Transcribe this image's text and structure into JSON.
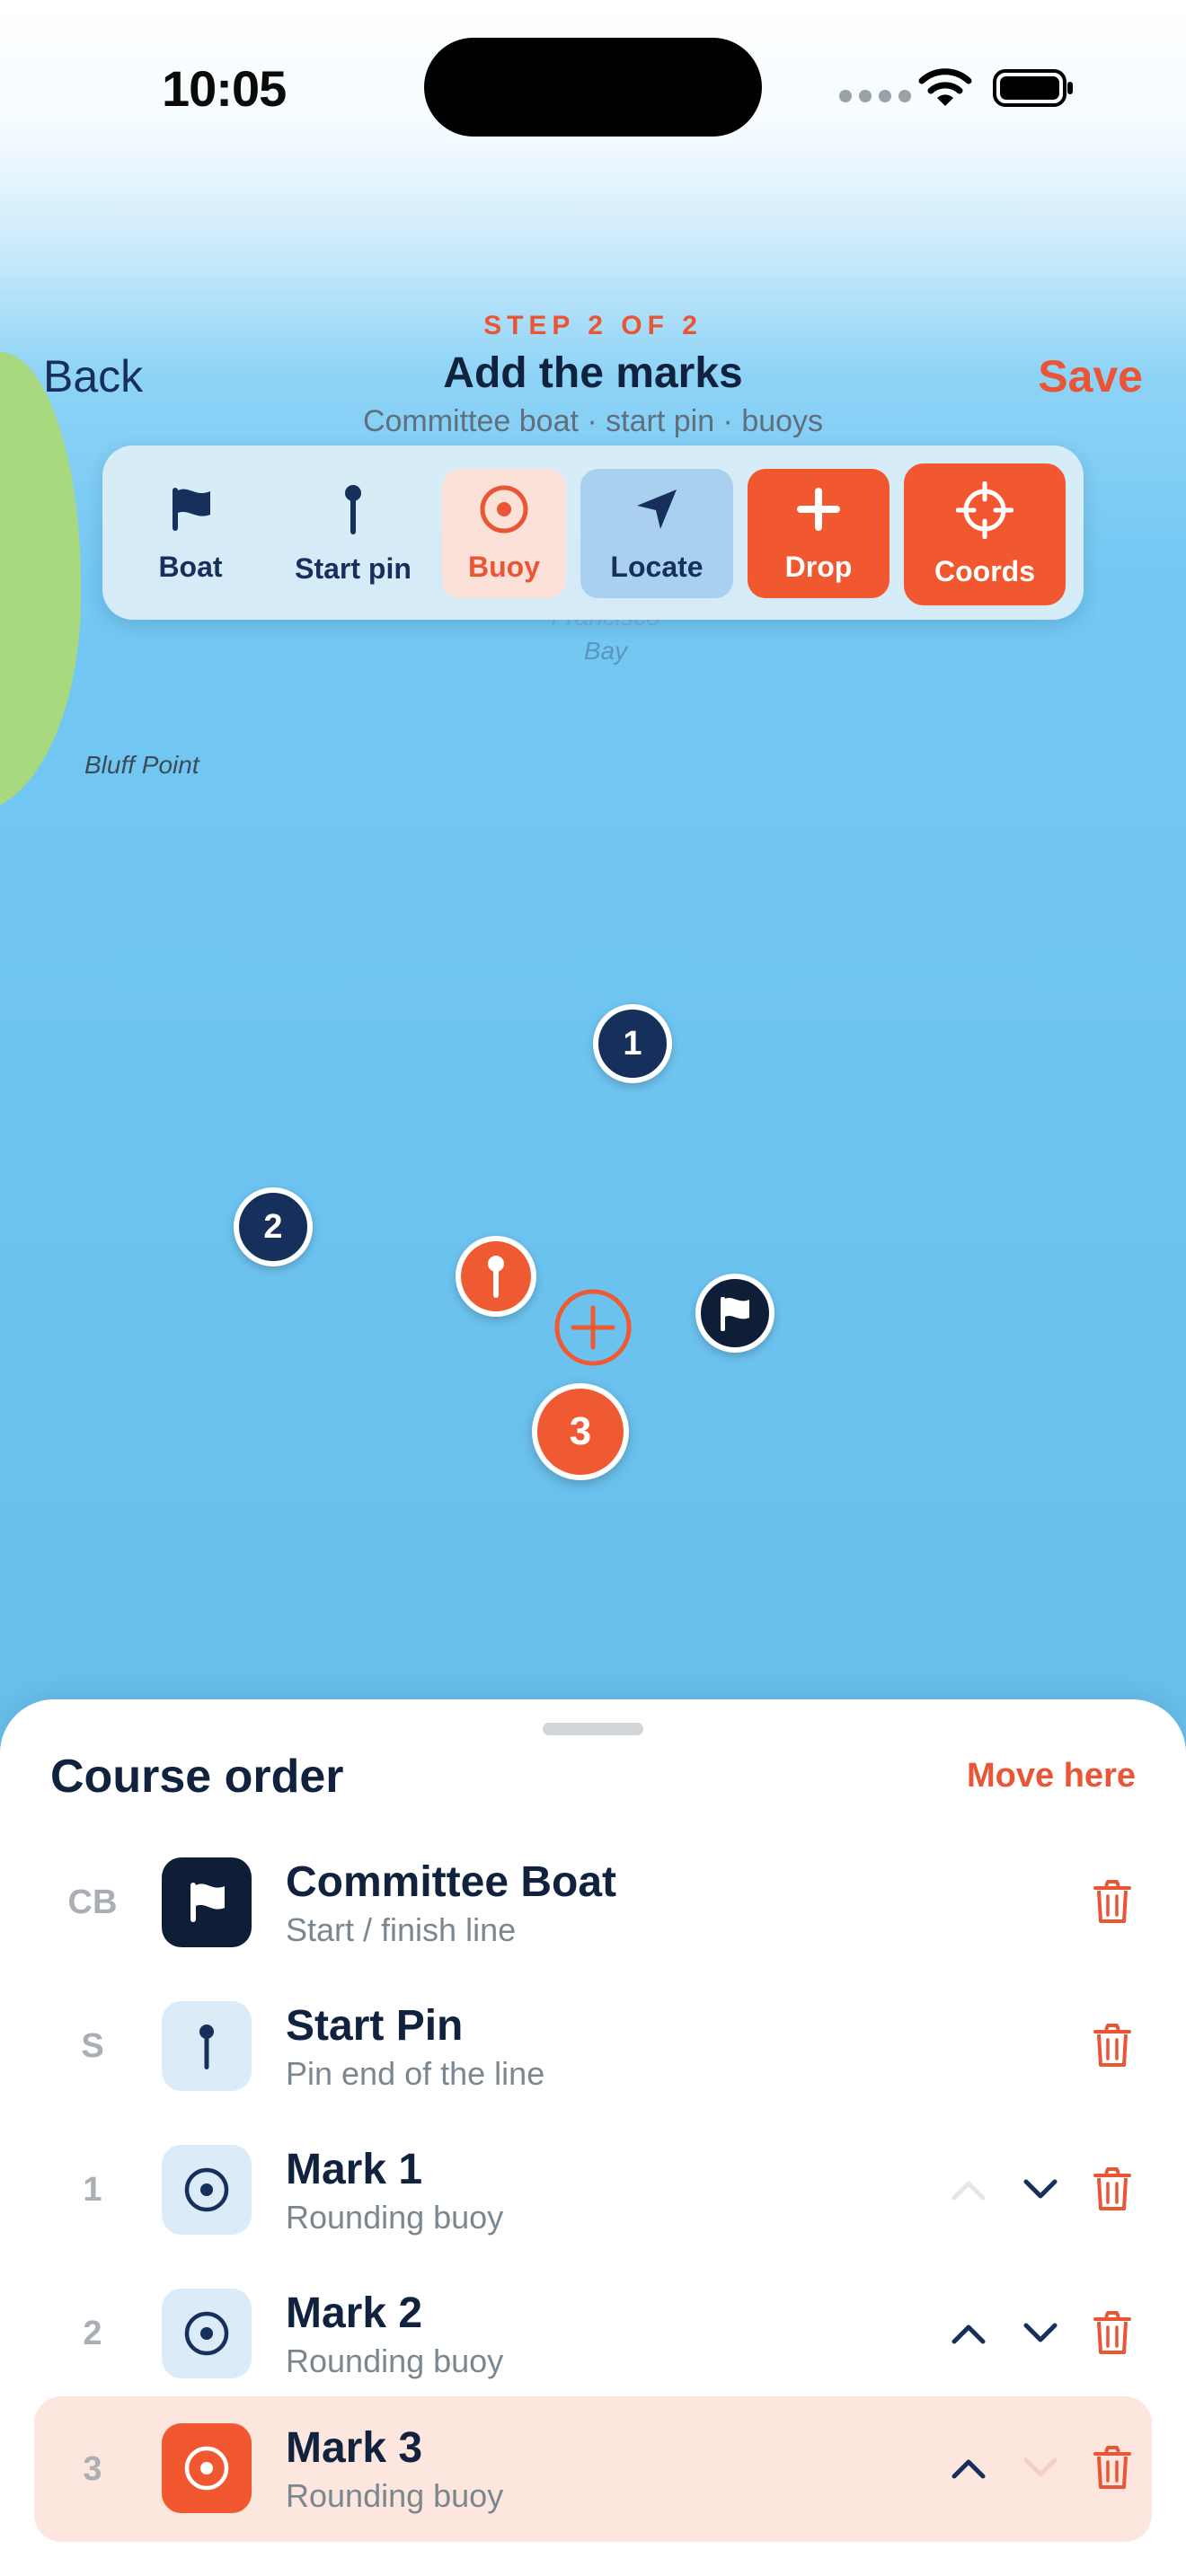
{
  "status_bar": {
    "time": "10:05"
  },
  "header": {
    "back_label": "Back",
    "save_label": "Save",
    "step_label": "STEP 2 OF 2",
    "title": "Add the marks",
    "subtitle": "Committee boat · start pin · buoys"
  },
  "toolbar": {
    "items": [
      {
        "label": "Boat",
        "icon": "flag-icon",
        "selected": false
      },
      {
        "label": "Start pin",
        "icon": "pin-icon",
        "selected": false
      },
      {
        "label": "Buoy",
        "icon": "buoy-icon",
        "selected": true
      },
      {
        "label": "Locate",
        "icon": "location-arrow-icon",
        "selected": false
      },
      {
        "label": "Drop",
        "icon": "plus-icon",
        "selected": false
      },
      {
        "label": "Coords",
        "icon": "crosshair-icon",
        "selected": false
      }
    ]
  },
  "map": {
    "land_label": "Bluff Point",
    "water_label_line1": "Francisco",
    "water_label_line2": "Bay",
    "markers": [
      {
        "label": "1",
        "kind": "mark"
      },
      {
        "label": "2",
        "kind": "mark"
      },
      {
        "label": "3",
        "kind": "mark-active"
      }
    ]
  },
  "sheet": {
    "title": "Course order",
    "move_here_label": "Move here",
    "rows": [
      {
        "index": "CB",
        "name": "Committee Boat",
        "subtitle": "Start / finish line",
        "icon": "flag-icon",
        "can_move_up": false,
        "can_move_down": false,
        "active": false
      },
      {
        "index": "S",
        "name": "Start Pin",
        "subtitle": "Pin end of the line",
        "icon": "pin-icon",
        "can_move_up": false,
        "can_move_down": false,
        "active": false
      },
      {
        "index": "1",
        "name": "Mark 1",
        "subtitle": "Rounding buoy",
        "icon": "buoy-icon",
        "can_move_up": false,
        "can_move_down": true,
        "active": false
      },
      {
        "index": "2",
        "name": "Mark 2",
        "subtitle": "Rounding buoy",
        "icon": "buoy-icon",
        "can_move_up": true,
        "can_move_down": true,
        "active": false
      },
      {
        "index": "3",
        "name": "Mark 3",
        "subtitle": "Rounding buoy",
        "icon": "buoy-icon",
        "can_move_up": true,
        "can_move_down": false,
        "active": true
      }
    ]
  },
  "colors": {
    "accent": "#ea5535",
    "navy": "#17305b",
    "dark": "#0e1e36",
    "water": "#6ec4f0",
    "land": "#a9d97e"
  }
}
